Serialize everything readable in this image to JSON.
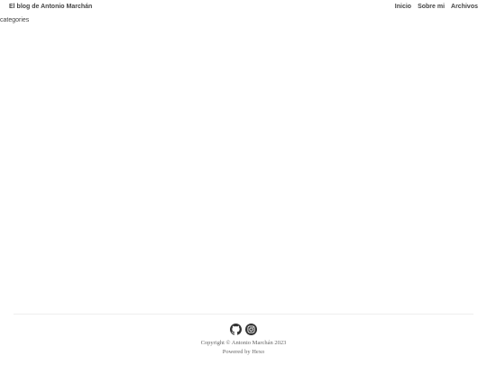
{
  "header": {
    "site_title": "El blog de Antonio Marchán",
    "nav": [
      {
        "label": "Inicio"
      },
      {
        "label": "Sobre mi"
      },
      {
        "label": "Archivos"
      }
    ]
  },
  "main": {
    "heading": "categories"
  },
  "footer": {
    "social_icons": [
      "github-icon",
      "instagram-icon"
    ],
    "copyright": "Copyright © Antonio Marchán 2023",
    "powered_prefix": "Powered by ",
    "powered_link": "Hexo"
  },
  "colors": {
    "text": "#333333",
    "footer_text": "#666666",
    "rule": "#eeeeee"
  }
}
